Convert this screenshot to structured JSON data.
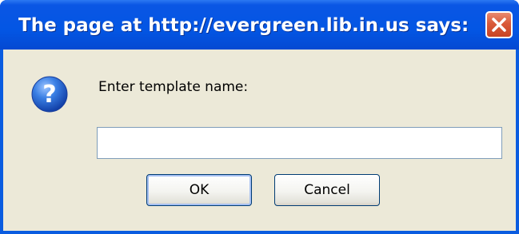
{
  "dialog": {
    "title": "The page at http://evergreen.lib.in.us says:",
    "prompt": "Enter template name:",
    "input_value": "",
    "ok_label": "OK",
    "cancel_label": "Cancel",
    "icons": {
      "close": "close-icon",
      "question": "question-icon"
    },
    "colors": {
      "titlebar": "#0356e4",
      "client": "#ece9d8",
      "close_button": "#d95a3a"
    }
  }
}
